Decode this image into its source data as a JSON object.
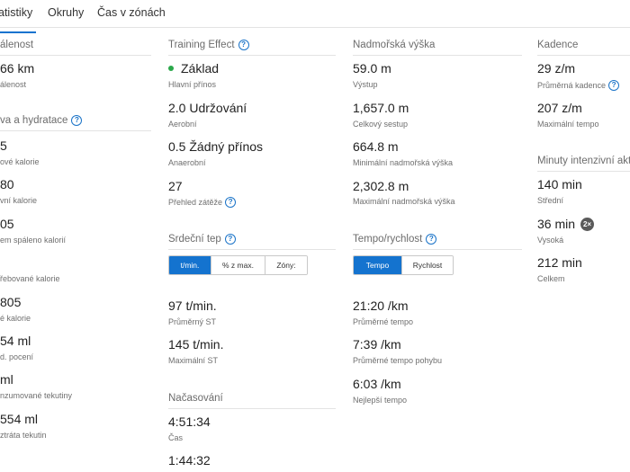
{
  "tabs": [
    {
      "label": "atistiky"
    },
    {
      "label": "Okruhy"
    },
    {
      "label": "Čas v zónách"
    }
  ],
  "col1": {
    "distance_title": "álenost",
    "distance_value": "66 km",
    "distance_label": "álenost",
    "nutrition_title": "va a hydratace",
    "items": [
      {
        "value": "5",
        "label": "ové kalorie"
      },
      {
        "value": "80",
        "label": "vní kalorie"
      },
      {
        "value": "05",
        "label": "em spáleno kalorií"
      },
      {
        "value": "",
        "label": "řebované kalorie"
      },
      {
        "value": "805",
        "label": "é kalorie"
      },
      {
        "value": "54 ml",
        "label": "d. pocení"
      },
      {
        "value": "ml",
        "label": "nzumované tekutiny"
      },
      {
        "value": "554 ml",
        "label": "ztráta tekutin"
      }
    ]
  },
  "col2": {
    "training_title": "Training Effect",
    "training": [
      {
        "value": "Základ",
        "label": "Hlavní přínos"
      },
      {
        "value": "2.0 Udržování",
        "label": "Aerobní"
      },
      {
        "value": "0.5 Žádný přínos",
        "label": "Anaerobní"
      },
      {
        "value": "27",
        "label": "Přehled zátěže"
      }
    ],
    "hr_title": "Srdeční tep",
    "hr_toggle": [
      "t/min.",
      "% z max.",
      "Zóny:"
    ],
    "hr": [
      {
        "value": "97 t/min.",
        "label": "Průměrný ST"
      },
      {
        "value": "145 t/min.",
        "label": "Maximální ST"
      }
    ],
    "timing_title": "Načasování",
    "timing": [
      {
        "value": "4:51:34",
        "label": "Čas"
      },
      {
        "value": "1:44:32",
        "label": ""
      }
    ]
  },
  "col3": {
    "elev_title": "Nadmořská výška",
    "elev": [
      {
        "value": "59.0 m",
        "label": "Výstup"
      },
      {
        "value": "1,657.0 m",
        "label": "Celkový sestup"
      },
      {
        "value": "664.8 m",
        "label": "Minimální nadmořská výška"
      },
      {
        "value": "2,302.8 m",
        "label": "Maximální nadmořská výška"
      }
    ],
    "pace_title": "Tempo/rychlost",
    "pace_toggle": [
      "Tempo",
      "Rychlost"
    ],
    "pace": [
      {
        "value": "21:20 /km",
        "label": "Průměrné tempo"
      },
      {
        "value": "7:39 /km",
        "label": "Průměrné tempo pohybu"
      },
      {
        "value": "6:03 /km",
        "label": "Nejlepší tempo"
      }
    ]
  },
  "col4": {
    "cadence_title": "Kadence",
    "cadence": [
      {
        "value": "29 z/m",
        "label": "Průměrná kadence"
      },
      {
        "value": "207 z/m",
        "label": "Maximální tempo"
      }
    ],
    "intensity_title": "Minuty intenzivní akti",
    "intensity": [
      {
        "value": "140 min",
        "label": "Střední"
      },
      {
        "value": "36 min",
        "label": "Vysoká",
        "badge": "2×"
      },
      {
        "value": "212 min",
        "label": "Celkem"
      }
    ]
  },
  "colors": {
    "accent": "#1473cf",
    "primary_benefit_dot": "#2aa84a"
  }
}
